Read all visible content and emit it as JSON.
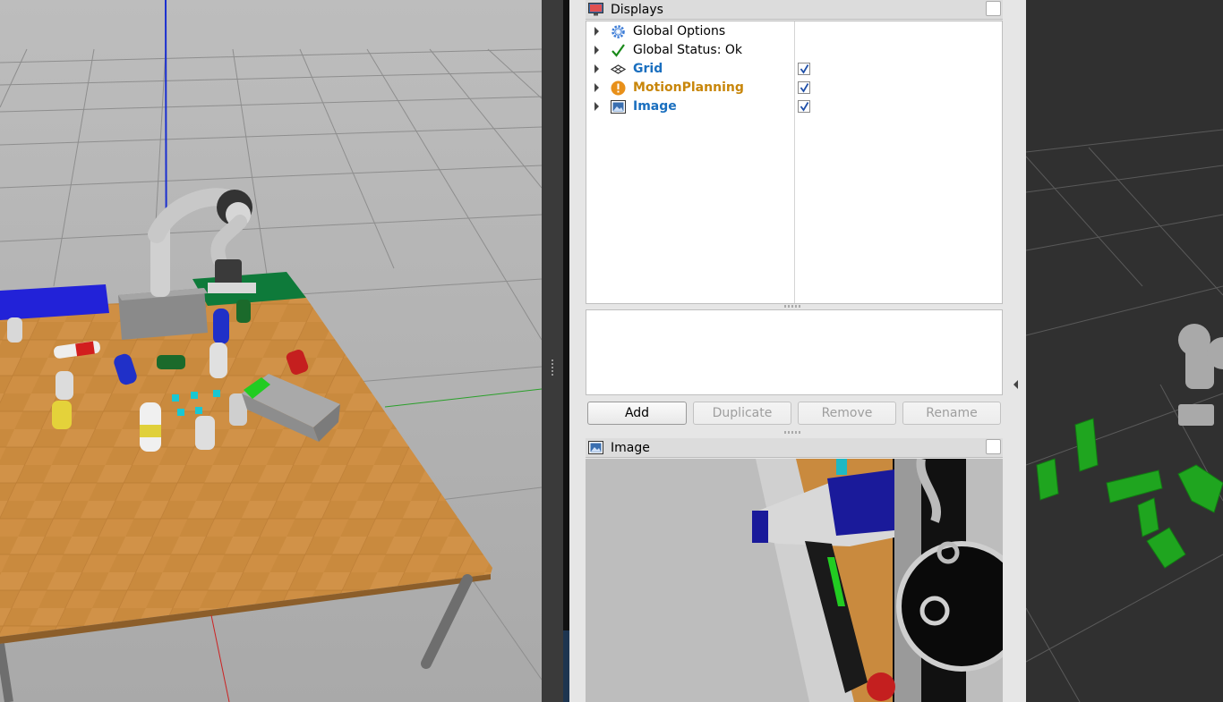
{
  "displays_panel": {
    "title": "Displays",
    "items": [
      {
        "label": "Global Options",
        "icon": "gear-icon",
        "style": "normal",
        "checked": null
      },
      {
        "label": "Global Status: Ok",
        "icon": "checkmark-icon",
        "style": "normal",
        "checked": null
      },
      {
        "label": "Grid",
        "icon": "grid-icon",
        "style": "blue",
        "checked": true
      },
      {
        "label": "MotionPlanning",
        "icon": "warning-icon",
        "style": "orange",
        "checked": true
      },
      {
        "label": "Image",
        "icon": "image-icon",
        "style": "blue",
        "checked": true
      }
    ],
    "buttons": {
      "add": "Add",
      "duplicate": "Duplicate",
      "remove": "Remove",
      "rename": "Rename"
    }
  },
  "image_panel": {
    "title": "Image"
  },
  "colors": {
    "link_blue": "#1a6fbf",
    "warning_orange": "#c8860a",
    "ok_green": "#1a8a1a"
  }
}
